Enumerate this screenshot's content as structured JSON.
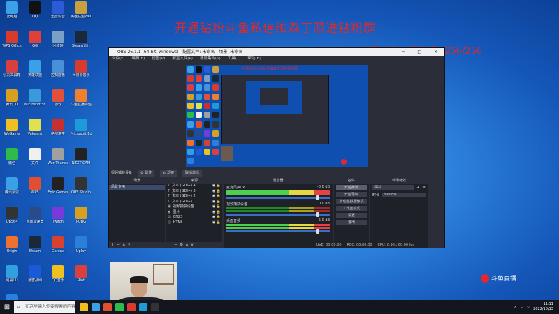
{
  "overlay": {
    "title": "开通钻粉斗鱼私信维森丁源进钻粉群",
    "subtitle": "紊质游戏 不说脏话！256/256",
    "watermark": "斗鱼直播"
  },
  "desktop_icons": [
    {
      "label": "此电脑",
      "color": "#3aa0e8"
    },
    {
      "label": "QQ",
      "color": "#111111"
    },
    {
      "label": "迅雷影音",
      "color": "#2c5bd8"
    },
    {
      "label": "英雄联盟WeGame",
      "color": "#c8a040"
    },
    {
      "label": "WPS Office",
      "color": "#d93a2e"
    },
    {
      "label": "GG",
      "color": "#e0403a"
    },
    {
      "label": "回收站",
      "color": "#7aa0c8"
    },
    {
      "label": "Steam运行",
      "color": "#1b2838"
    },
    {
      "label": "小丸工具箱",
      "color": "#d84040"
    },
    {
      "label": "英雄联盟",
      "color": "#3aa0e8"
    },
    {
      "label": "控制面板",
      "color": "#4a90d9"
    },
    {
      "label": "网易云音乐",
      "color": "#d93a2e"
    },
    {
      "label": "腾讯QQ",
      "color": "#d8a020"
    },
    {
      "label": "Microsoft Store",
      "color": "#3a9ad9"
    },
    {
      "label": "游戏",
      "color": "#e0503a"
    },
    {
      "label": "斗鱼直播伴侣",
      "color": "#f08030"
    },
    {
      "label": "WeGame",
      "color": "#f0c020"
    },
    {
      "label": "Valorant",
      "color": "#e0e050"
    },
    {
      "label": "绝地求生",
      "color": "#c83030"
    },
    {
      "label": "Microsoft Edge",
      "color": "#1f9ad9"
    },
    {
      "label": "微信",
      "color": "#2dbb4a"
    },
    {
      "label": "文件",
      "color": "#f0f0f0"
    },
    {
      "label": "War Thunder",
      "color": "#a0a0a0"
    },
    {
      "label": "NZXT CAM",
      "color": "#222222"
    },
    {
      "label": "腾讯会议",
      "color": "#3aa0e8"
    },
    {
      "label": "WPS",
      "color": "#e05030"
    },
    {
      "label": "Epic Games",
      "color": "#222222"
    },
    {
      "label": "OBS Studio",
      "color": "#333333"
    },
    {
      "label": "OBS64",
      "color": "#333333"
    },
    {
      "label": "游戏加速器",
      "color": "#2a4a8a"
    },
    {
      "label": "Twitch",
      "color": "#7a3ad9"
    },
    {
      "label": "PUBG",
      "color": "#d8a020"
    },
    {
      "label": "Origin",
      "color": "#f07030"
    },
    {
      "label": "Steam",
      "color": "#1b2838"
    },
    {
      "label": "Garena",
      "color": "#d84030"
    },
    {
      "label": "Uplay",
      "color": "#2a80d8"
    },
    {
      "label": "网易UU",
      "color": "#30a0e0"
    },
    {
      "label": "暴雪战网",
      "color": "#1a5ad8"
    },
    {
      "label": "QQ音乐",
      "color": "#f0c020"
    },
    {
      "label": "Riot",
      "color": "#d84040"
    },
    {
      "label": "腾讯视频",
      "color": "#2a80e0"
    }
  ],
  "obs": {
    "title": "OBS 26.1.1 (64-bit, windows) - 配置文件: 未命名 - 场景: 未命名",
    "menu": [
      "文件(F)",
      "编辑(E)",
      "视图(V)",
      "配置文件(P)",
      "场景集合(S)",
      "工具(T)",
      "帮助(H)"
    ],
    "scene_bar": {
      "label": "视频捕获设备",
      "props": "⚙ 属性",
      "filters": "◐ 滤镜",
      "device_btn": "取消激活"
    },
    "docks": {
      "scenes": "场景",
      "sources": "来源",
      "mixer": "混音器",
      "transitions": "转场特效",
      "controls": "控件"
    },
    "scenes": [
      "场景专用"
    ],
    "sources": [
      {
        "icon": "T",
        "name": "文本 (GDI+) 4"
      },
      {
        "icon": "T",
        "name": "文本 (GDI+) 3"
      },
      {
        "icon": "T",
        "name": "文本 (GDI+) 2"
      },
      {
        "icon": "T",
        "name": "文本 (GDI+)"
      },
      {
        "icon": "▣",
        "name": "视频捕获设备"
      },
      {
        "icon": "◉",
        "name": "图片"
      },
      {
        "icon": "▤",
        "name": "CNZ3"
      },
      {
        "icon": "▤",
        "name": "HTML"
      }
    ],
    "mixer": [
      {
        "name": "麦克风/Aux",
        "db": "-0.0 dB",
        "active": true
      },
      {
        "name": "视频捕获设备",
        "db": "0.0 dB",
        "active": false
      },
      {
        "name": "桌面音频",
        "db": "-5.0 dB",
        "active": true
      }
    ],
    "controls": [
      "开始推流",
      "开始录制",
      "启动虚拟摄像机",
      "工作室模式",
      "设置",
      "退出"
    ],
    "transition": {
      "type": "淡出",
      "duration_label": "时长",
      "duration": "300 ms"
    },
    "status": {
      "live": "LIVE: 00:00:00",
      "rec": "REC: 00:00:00",
      "cpu": "CPU: 0.9%, 60.00 fps"
    }
  },
  "taskbar": {
    "search_placeholder": "在这里输入你要搜索的内容",
    "time": "11:11",
    "date": "2022/10/13",
    "apps": [
      "#f0c020",
      "#3aa0e8",
      "#e05030",
      "#2dbb4a",
      "#d93a2e",
      "#1f9ad9",
      "#333333"
    ]
  }
}
